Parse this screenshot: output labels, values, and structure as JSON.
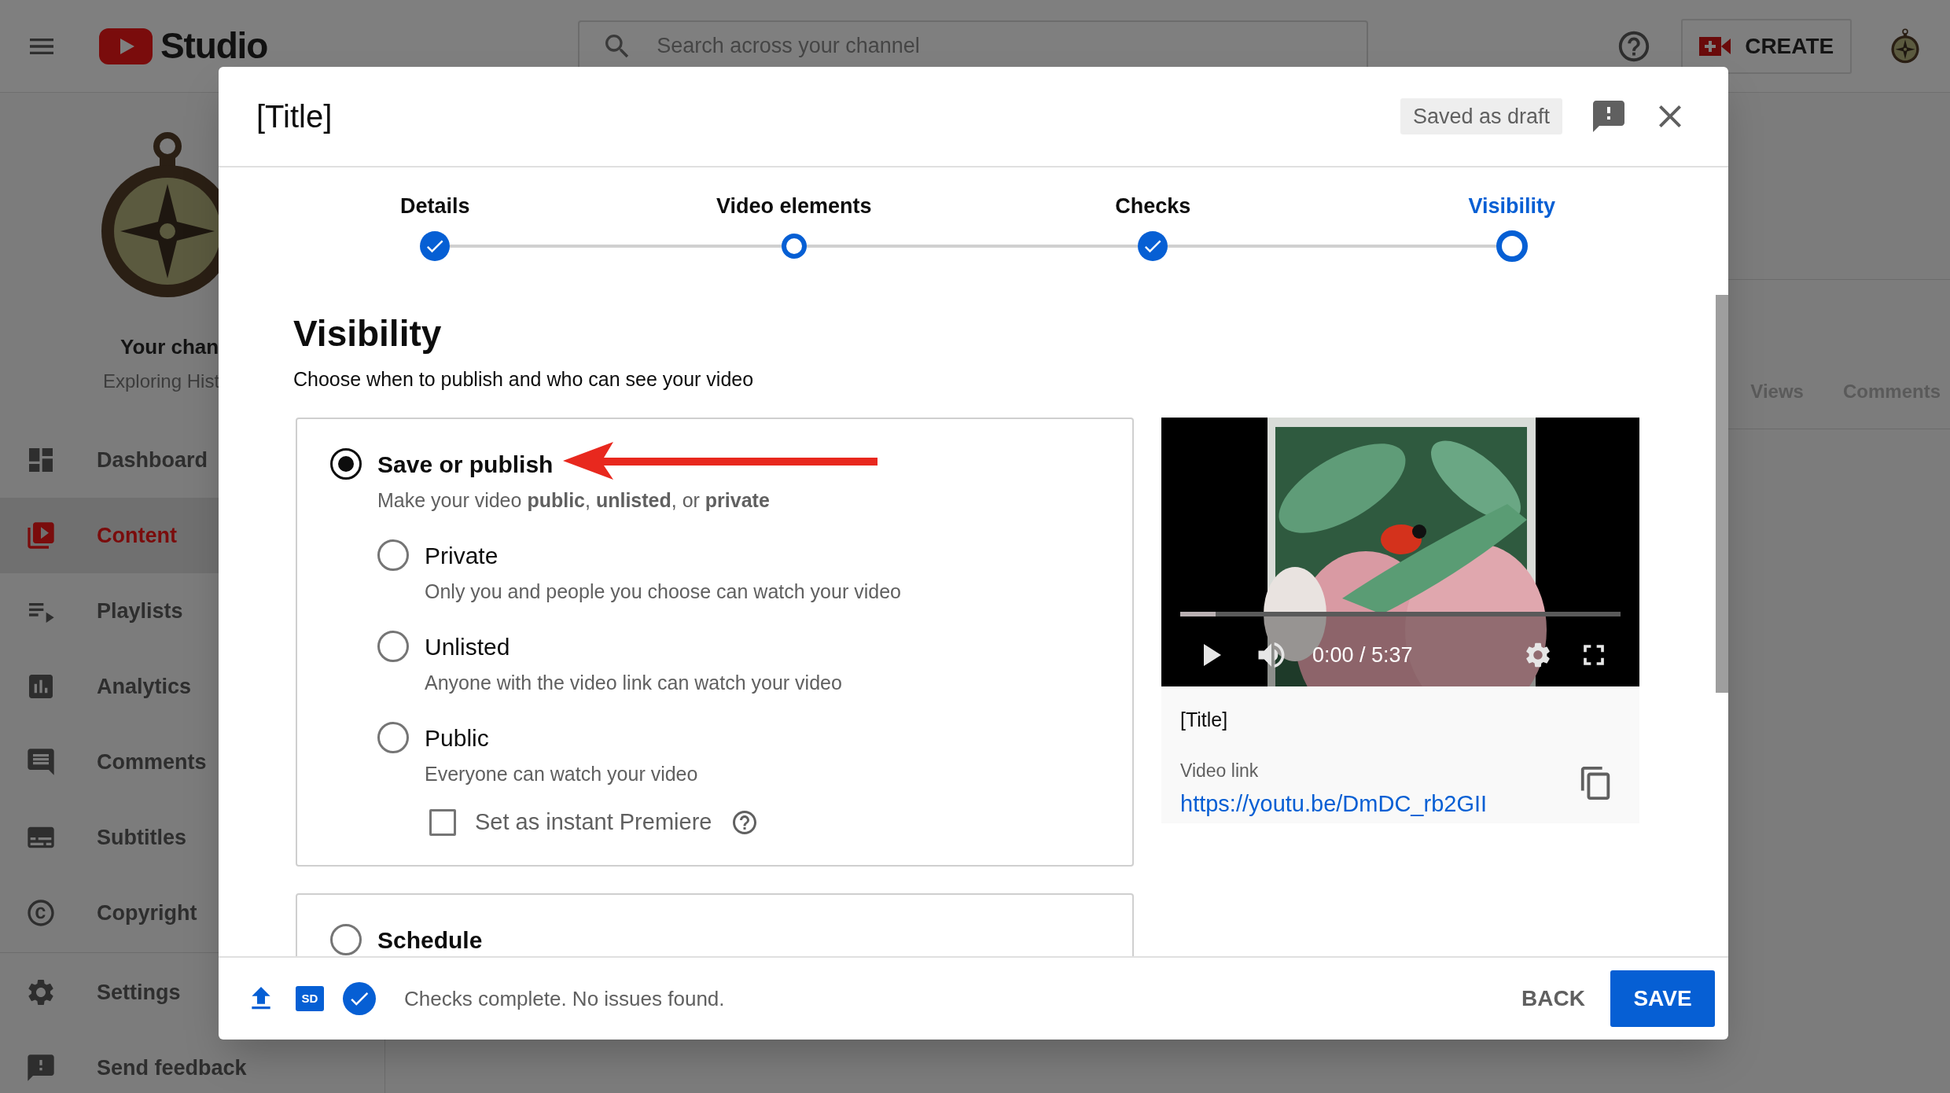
{
  "topbar": {
    "logo_text": "Studio",
    "search": {
      "placeholder": "Search across your channel"
    },
    "create_button": "CREATE"
  },
  "sidebar": {
    "channel_name": "Your chan",
    "channel_subtitle": "Exploring Hist",
    "sections": [
      {
        "items": [
          {
            "label": "Dashboard",
            "selected": false
          },
          {
            "label": "Content",
            "selected": true
          },
          {
            "label": "Playlists",
            "selected": false
          },
          {
            "label": "Analytics",
            "selected": false
          },
          {
            "label": "Comments",
            "selected": false
          },
          {
            "label": "Subtitles",
            "selected": false
          },
          {
            "label": "Copyright",
            "selected": false
          }
        ]
      },
      {
        "items": [
          {
            "label": "Settings",
            "selected": false
          },
          {
            "label": "Send feedback",
            "selected": false
          }
        ]
      }
    ]
  },
  "table": {
    "columns": [
      "Views",
      "Comments"
    ]
  },
  "dialog": {
    "title": "[Title]",
    "draft_status": "Saved as draft",
    "steps": [
      {
        "label": "Details",
        "done": true,
        "selected": false
      },
      {
        "label": "Video elements",
        "done": false,
        "selected": false
      },
      {
        "label": "Checks",
        "done": true,
        "selected": false
      },
      {
        "label": "Visibility",
        "done": false,
        "selected": true
      }
    ],
    "heading": "Visibility",
    "subtitle": "Choose when to publish and who can see your video",
    "groups": [
      {
        "label": "Save or publish",
        "description": "Make your video **public**, **unlisted**, or **private**",
        "selected": true,
        "options": [
          {
            "label": "Private",
            "description": "Only you and people you choose can watch your video",
            "selected": false
          },
          {
            "label": "Unlisted",
            "description": "Anyone with the video link can watch your video",
            "selected": false
          },
          {
            "label": "Public",
            "description": "Everyone can watch your video",
            "selected": false,
            "premiere": {
              "label": "Set as instant Premiere",
              "checked": false
            }
          }
        ]
      },
      {
        "label": "Schedule",
        "selected": false
      }
    ],
    "preview": {
      "time": "0:00 / 5:37",
      "progress": {
        "level": 0.08
      },
      "title": "[Title]",
      "link_label": "Video link",
      "link": "https://youtu.be/DmDC_rb2GII"
    },
    "footer": {
      "quality_badge": "SD",
      "status": "Checks complete. No issues found.",
      "back": "BACK",
      "save": "SAVE"
    }
  }
}
